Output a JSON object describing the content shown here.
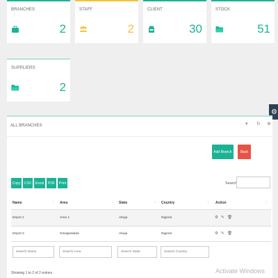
{
  "colors": {
    "green": "#1cb394",
    "yellow": "#f5c33b",
    "red": "#e55546",
    "teal_light": "#b5e3dc"
  },
  "cards": [
    {
      "title": "BRANCHES",
      "value": "2",
      "icon": "briefcase-icon",
      "accent": "#1cb394"
    },
    {
      "title": "STAFF",
      "value": "2",
      "icon": "users-icon",
      "accent": "#f5c33b"
    },
    {
      "title": "CLIENT",
      "value": "30",
      "icon": "client-icon",
      "accent": "#1cb394"
    },
    {
      "title": "STOCK",
      "value": "51",
      "icon": "folder-icon",
      "accent": "#1cb394"
    },
    {
      "title": "SUPPLIERS",
      "value": "2",
      "icon": "folder-icon",
      "accent": "#b5e3dc"
    }
  ],
  "panel": {
    "title": "ALL BRANCHES",
    "collapse_icon": "chevron-down-icon",
    "refresh_icon": "refresh-icon",
    "add_label": "Add Branch",
    "back_label": "Back",
    "export_buttons": [
      "Copy",
      "CSV",
      "Excel",
      "PDF",
      "Print"
    ],
    "search_label": "Search:",
    "columns": [
      "Name",
      "Area",
      "State",
      "Country",
      "Action"
    ],
    "rows": [
      {
        "name": "Depot 1",
        "area": "Area 1",
        "state": "Abuja",
        "country": "Nigeria"
      },
      {
        "name": "Depot 2",
        "area": "Gwagwalada",
        "state": "Abuja",
        "country": "Nigeria"
      }
    ],
    "filters": [
      "Search Name",
      "Search Area",
      "Search State",
      "Search Country"
    ],
    "info": "Showing 1 to 2 of 2 entries"
  },
  "watermark": "Activate Windows"
}
